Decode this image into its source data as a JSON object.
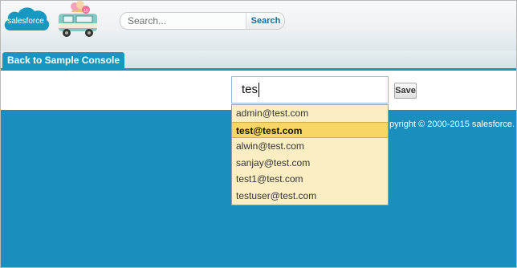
{
  "header": {
    "logo_text": "salesforce",
    "search": {
      "placeholder": "Search...",
      "button_label": "Search"
    }
  },
  "tabbar": {
    "tab_label": "Back to Sample Console"
  },
  "form": {
    "input_value": "tes",
    "save_label": "Save"
  },
  "suggestions": [
    {
      "label": "admin@test.com"
    },
    {
      "label": "test@test.com"
    },
    {
      "label": "alwin@test.com"
    },
    {
      "label": "sanjay@test.com"
    },
    {
      "label": "test1@test.com"
    },
    {
      "label": "testuser@test.com"
    }
  ],
  "footer": {
    "copyright": "pyright © 2000-2015 salesforce."
  },
  "colors": {
    "brand_blue": "#1797c0",
    "page_blue": "#1a8fbd",
    "highlight": "#f7d665",
    "dropdown_bg": "#fbeec2"
  }
}
